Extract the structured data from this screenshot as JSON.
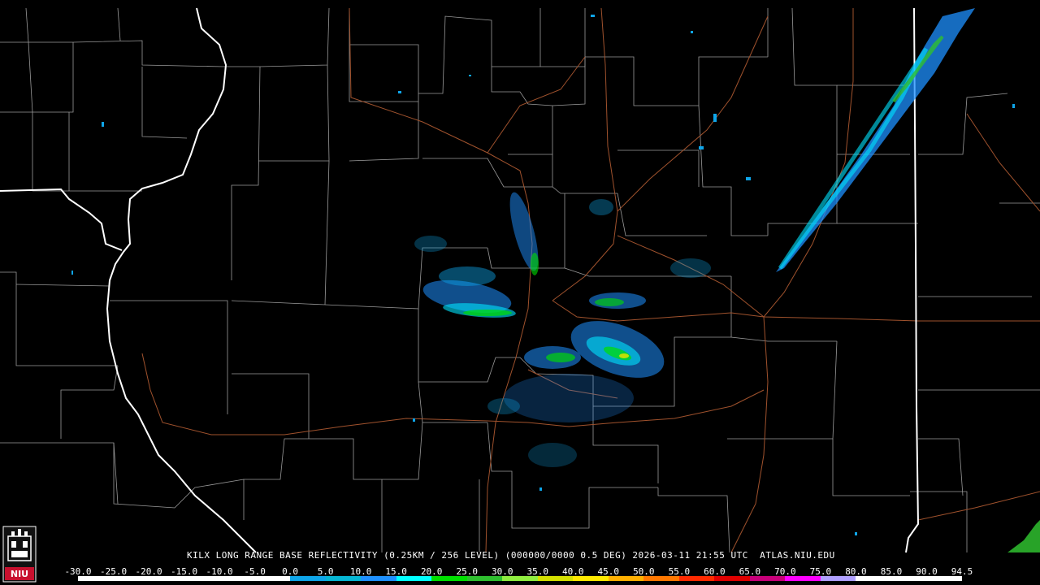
{
  "caption": "KILX LONG RANGE BASE REFLECTIVITY (0.25KM / 256 LEVEL) (000000/0000 0.5 DEG) 2026-03-11 21:55 UTC  ATLAS.NIU.EDU",
  "logo_text": "NIU",
  "scale": {
    "labels": [
      "-30.0",
      "-25.0",
      "-20.0",
      "-15.0",
      "-10.0",
      "-5.0",
      "0.0",
      "5.0",
      "10.0",
      "15.0",
      "20.0",
      "25.0",
      "30.0",
      "35.0",
      "40.0",
      "45.0",
      "50.0",
      "55.0",
      "60.0",
      "65.0",
      "70.0",
      "75.0",
      "80.0",
      "85.0",
      "90.0",
      "94.5"
    ],
    "colors": [
      "#ffffff",
      "#ffffff",
      "#ffffff",
      "#ffffff",
      "#ffffff",
      "#ffffff",
      "#0ea5e9",
      "#06b6d4",
      "#1e90ff",
      "#00ffff",
      "#00e000",
      "#2fbf2f",
      "#90ee40",
      "#d4e000",
      "#ffea00",
      "#ffb000",
      "#ff7800",
      "#ff2a00",
      "#e00000",
      "#c8007a",
      "#ff00ff",
      "#b0a0ff",
      "#ffffff",
      "#ffffff",
      "#ffffff"
    ]
  },
  "colors": {
    "background": "#000000",
    "county_lines": "#9a9a9a",
    "state_lines": "#ffffff",
    "roads": "#a0522d"
  }
}
